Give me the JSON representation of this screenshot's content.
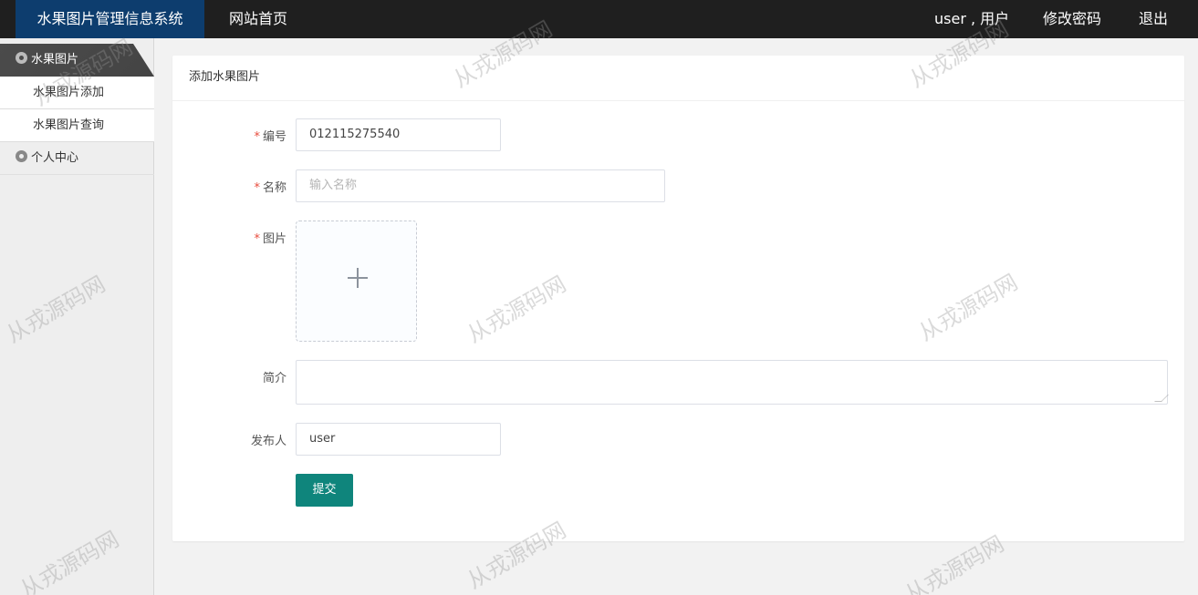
{
  "header": {
    "brand": "水果图片管理信息系统",
    "home_link": "网站首页",
    "user_info": "user , 用户",
    "change_password": "修改密码",
    "logout": "退出"
  },
  "sidebar": {
    "groups": [
      {
        "label": "水果图片",
        "items": [
          {
            "label": "水果图片添加"
          },
          {
            "label": "水果图片查询"
          }
        ]
      },
      {
        "label": "个人中心",
        "items": []
      }
    ]
  },
  "form": {
    "title": "添加水果图片",
    "fields": {
      "code": {
        "label": "编号",
        "required": "*",
        "value": "012115275540"
      },
      "name": {
        "label": "名称",
        "required": "*",
        "placeholder": "输入名称",
        "value": ""
      },
      "image": {
        "label": "图片",
        "required": "*"
      },
      "intro": {
        "label": "简介",
        "value": ""
      },
      "publisher": {
        "label": "发布人",
        "value": "user"
      }
    },
    "submit_label": "提交"
  },
  "watermark": "从戎源码网",
  "colors": {
    "header_bg": "#1f1f1f",
    "brand_bg": "#0d3d6e",
    "submit_bg": "#0f857c",
    "required": "#e84c3d"
  }
}
